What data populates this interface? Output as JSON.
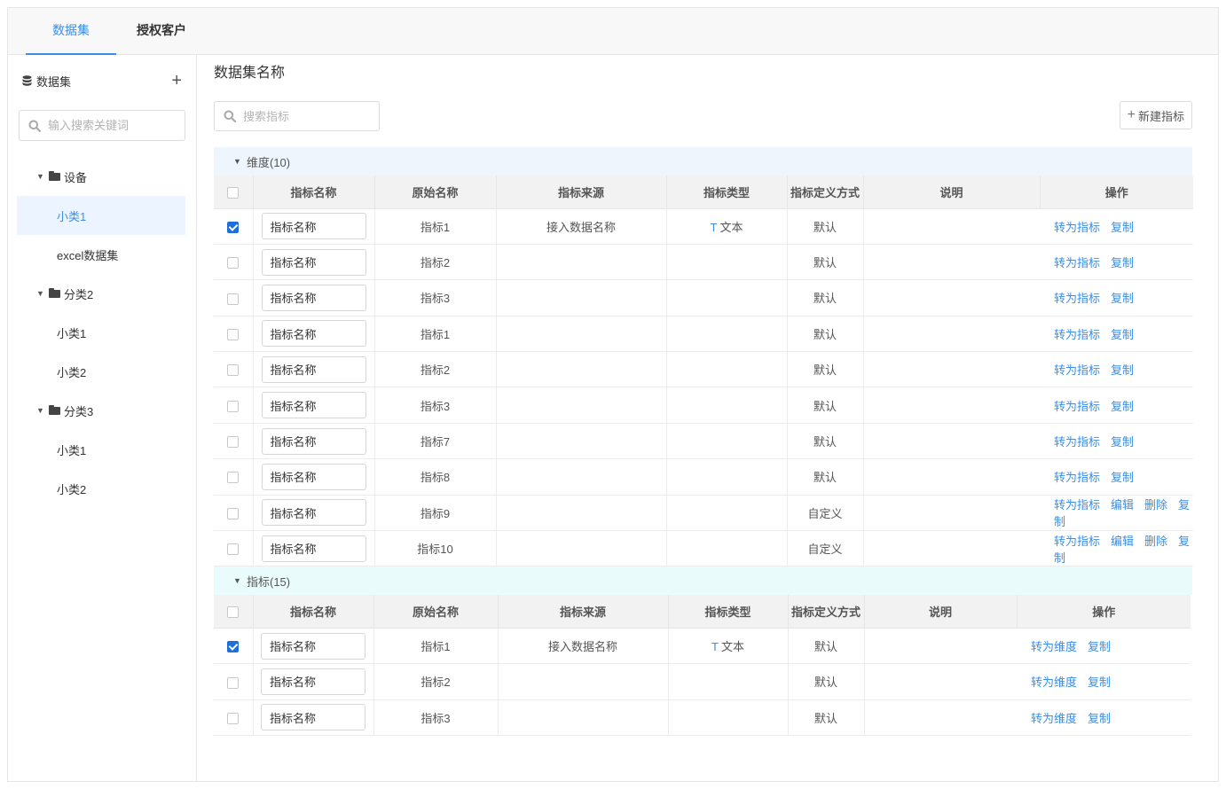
{
  "tabs": [
    "数据集",
    "授权客户"
  ],
  "sidebar": {
    "title": "数据集",
    "add_symbol": "+",
    "search_placeholder": "输入搜索关键词",
    "tree": [
      {
        "type": "folder",
        "label": "设备"
      },
      {
        "type": "leaf",
        "label": "小类1",
        "selected": true
      },
      {
        "type": "leaf",
        "label": "excel数据集"
      },
      {
        "type": "folder",
        "label": "分类2"
      },
      {
        "type": "leaf",
        "label": "小类1"
      },
      {
        "type": "leaf",
        "label": "小类2"
      },
      {
        "type": "folder",
        "label": "分类3"
      },
      {
        "type": "leaf",
        "label": "小类1"
      },
      {
        "type": "leaf",
        "label": "小类2"
      }
    ]
  },
  "main": {
    "title": "数据集名称",
    "search_placeholder": "搜索指标",
    "new_button": "新建指标",
    "columns": [
      "指标名称",
      "原始名称",
      "指标来源",
      "指标类型",
      "指标定义方式",
      "说明",
      "操作"
    ],
    "name_input_value": "指标名称",
    "dimension_group": {
      "label": "维度(10)",
      "rows": [
        {
          "checked": true,
          "original": "指标1",
          "source": "接入数据名称",
          "type_icon": "T",
          "type": "文本",
          "define": "默认",
          "actions": [
            "转为指标",
            "复制"
          ]
        },
        {
          "checked": false,
          "original": "指标2",
          "source": "",
          "type_icon": "",
          "type": "",
          "define": "默认",
          "actions": [
            "转为指标",
            "复制"
          ]
        },
        {
          "checked": false,
          "original": "指标3",
          "source": "",
          "type_icon": "",
          "type": "",
          "define": "默认",
          "actions": [
            "转为指标",
            "复制"
          ]
        },
        {
          "checked": false,
          "original": "指标1",
          "source": "",
          "type_icon": "",
          "type": "",
          "define": "默认",
          "actions": [
            "转为指标",
            "复制"
          ]
        },
        {
          "checked": false,
          "original": "指标2",
          "source": "",
          "type_icon": "",
          "type": "",
          "define": "默认",
          "actions": [
            "转为指标",
            "复制"
          ]
        },
        {
          "checked": false,
          "original": "指标3",
          "source": "",
          "type_icon": "",
          "type": "",
          "define": "默认",
          "actions": [
            "转为指标",
            "复制"
          ]
        },
        {
          "checked": false,
          "original": "指标7",
          "source": "",
          "type_icon": "",
          "type": "",
          "define": "默认",
          "actions": [
            "转为指标",
            "复制"
          ]
        },
        {
          "checked": false,
          "original": "指标8",
          "source": "",
          "type_icon": "",
          "type": "",
          "define": "默认",
          "actions": [
            "转为指标",
            "复制"
          ]
        },
        {
          "checked": false,
          "original": "指标9",
          "source": "",
          "type_icon": "",
          "type": "",
          "define": "自定义",
          "actions": [
            "转为指标",
            "编辑",
            "删除",
            "复制"
          ]
        },
        {
          "checked": false,
          "original": "指标10",
          "source": "",
          "type_icon": "",
          "type": "",
          "define": "自定义",
          "actions": [
            "转为指标",
            "编辑",
            "删除",
            "复制"
          ]
        }
      ]
    },
    "metric_group": {
      "label": "指标(15)",
      "rows": [
        {
          "checked": true,
          "original": "指标1",
          "source": "接入数据名称",
          "type_icon": "T",
          "type": "文本",
          "define": "默认",
          "actions": [
            "转为维度",
            "复制"
          ]
        },
        {
          "checked": false,
          "original": "指标2",
          "source": "",
          "type_icon": "",
          "type": "",
          "define": "默认",
          "actions": [
            "转为维度",
            "复制"
          ]
        },
        {
          "checked": false,
          "original": "指标3",
          "source": "",
          "type_icon": "",
          "type": "",
          "define": "默认",
          "actions": [
            "转为维度",
            "复制"
          ]
        }
      ]
    }
  },
  "colors": {
    "accent": "#3a8ee6",
    "checkbox": "#1e6fd9",
    "dim_group_bg": "#eef5fd",
    "metric_group_bg": "#eafbfb"
  }
}
